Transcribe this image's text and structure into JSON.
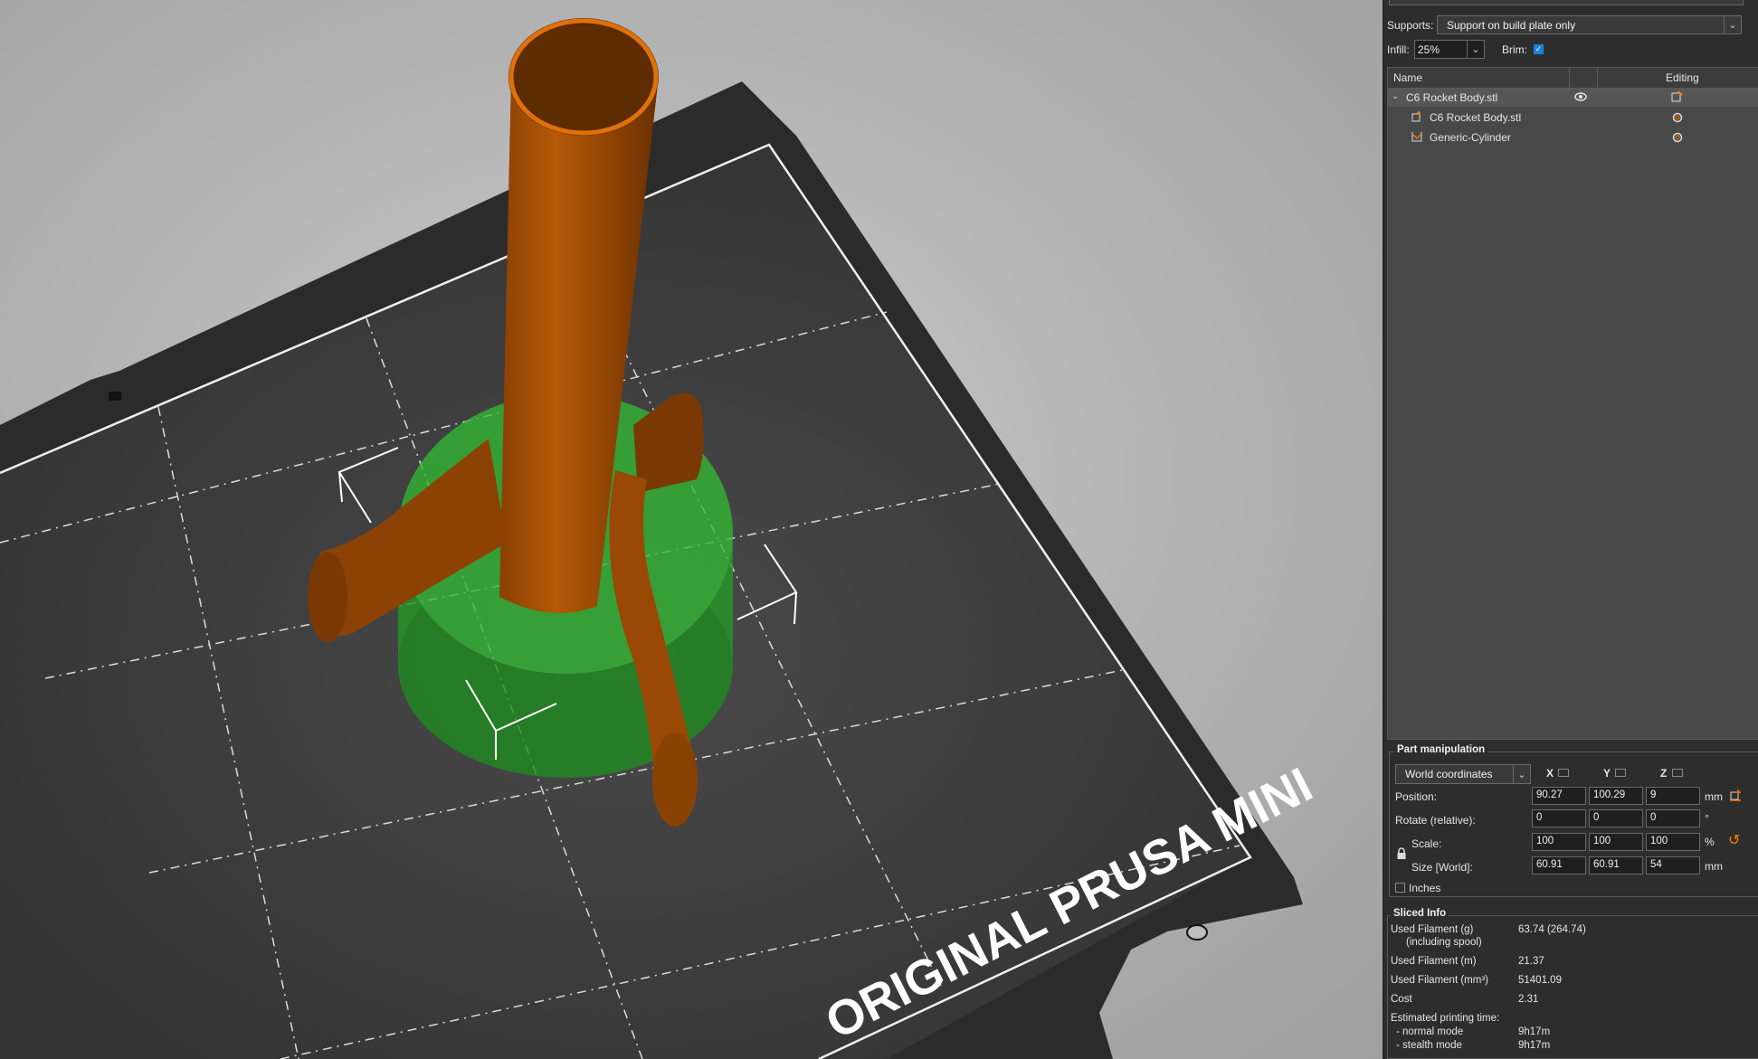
{
  "colors": {
    "model": "#a34f06",
    "model_dark": "#7a3a04",
    "modifier": "#2fb52f",
    "bed": "#3a3a3a",
    "accent": "#ff7a00",
    "checkbox": "#1e7fd8"
  },
  "viewport": {
    "bed_label": "ORIGINAL PRUSA MINI"
  },
  "sidebar": {
    "supports_label": "Supports:",
    "supports_value": "Support on build plate only",
    "infill_label": "Infill:",
    "infill_value": "25%",
    "brim_label": "Brim:",
    "brim_checked": true
  },
  "object_list": {
    "col_name": "Name",
    "col_editing": "Editing",
    "items": [
      {
        "name": "C6 Rocket Body.stl",
        "icon": "eye-icon",
        "edit_icon": "edit-icon",
        "type": "object"
      },
      {
        "name": "C6 Rocket Body.stl",
        "icon": "part-icon",
        "edit_icon": "settings-gear-icon",
        "type": "part"
      },
      {
        "name": "Generic-Cylinder",
        "icon": "modifier-icon",
        "edit_icon": "settings-gear-icon",
        "type": "modifier"
      }
    ]
  },
  "part_manipulation": {
    "title": "Part manipulation",
    "coords_value": "World coordinates",
    "axes": [
      "X",
      "Y",
      "Z"
    ],
    "position_label": "Position:",
    "position": [
      "90.27",
      "100.29",
      "9"
    ],
    "position_unit": "mm",
    "rotate_label": "Rotate (relative):",
    "rotate": [
      "0",
      "0",
      "0"
    ],
    "rotate_unit": "°",
    "scale_label": "Scale:",
    "scale": [
      "100",
      "100",
      "100"
    ],
    "scale_unit": "%",
    "size_label": "Size [World]:",
    "size": [
      "60.91",
      "60.91",
      "54"
    ],
    "size_unit": "mm",
    "inches_label": "Inches"
  },
  "sliced_info": {
    "title": "Sliced Info",
    "used_filament_g_label": "Used Filament (g)",
    "including_spool_label": "(including spool)",
    "used_filament_g_value": "63.74 (264.74)",
    "used_filament_m_label": "Used Filament (m)",
    "used_filament_m_value": "21.37",
    "used_filament_mm3_label": "Used Filament (mm³)",
    "used_filament_mm3_value": "51401.09",
    "cost_label": "Cost",
    "cost_value": "2.31",
    "est_time_label": "Estimated printing time:",
    "normal_mode_label": "- normal mode",
    "normal_mode_value": "9h17m",
    "stealth_mode_label": "- stealth mode",
    "stealth_mode_value": "9h17m"
  }
}
